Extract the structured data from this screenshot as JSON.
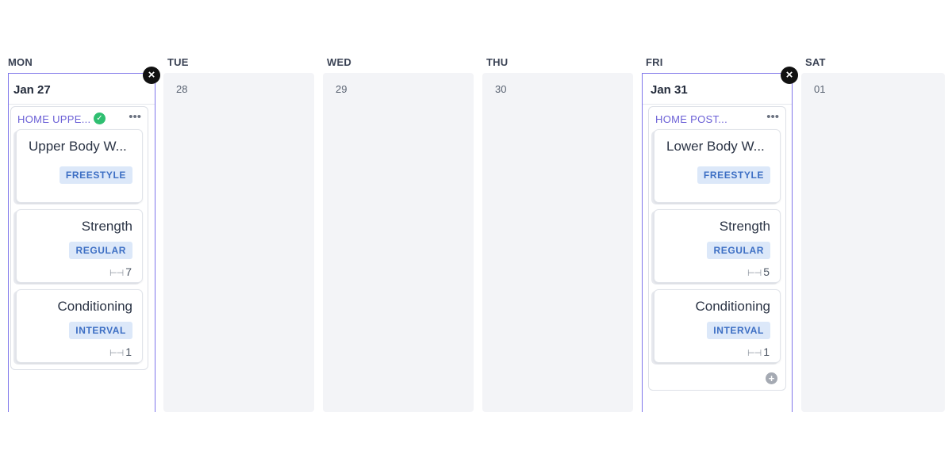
{
  "days": {
    "mon": {
      "label": "MON",
      "date": "Jan 27"
    },
    "tue": {
      "label": "TUE",
      "date": "28"
    },
    "wed": {
      "label": "WED",
      "date": "29"
    },
    "thu": {
      "label": "THU",
      "date": "30"
    },
    "fri": {
      "label": "FRI",
      "date": "Jan 31"
    },
    "sat": {
      "label": "SAT",
      "date": "01"
    }
  },
  "icons": {
    "close": "×",
    "check": "✓",
    "more": "•••",
    "add": "+",
    "dumbbell": "⊢⊣"
  },
  "mon_program": {
    "title": "HOME UPPE...",
    "cards": [
      {
        "title": "Upper Body W...",
        "badge": "FREESTYLE"
      },
      {
        "title": "Strength",
        "badge": "REGULAR",
        "count": "7"
      },
      {
        "title": "Conditioning",
        "badge": "INTERVAL",
        "count": "1"
      }
    ]
  },
  "fri_program": {
    "title": "HOME POST...",
    "cards": [
      {
        "title": "Lower Body W...",
        "badge": "FREESTYLE"
      },
      {
        "title": "Strength",
        "badge": "REGULAR",
        "count": "5"
      },
      {
        "title": "Conditioning",
        "badge": "INTERVAL",
        "count": "1"
      }
    ]
  },
  "colors": {
    "accent": "#7f75ea",
    "badge_bg": "#dce8f9",
    "badge_text": "#3d6fc4",
    "check": "#2fbf71"
  }
}
